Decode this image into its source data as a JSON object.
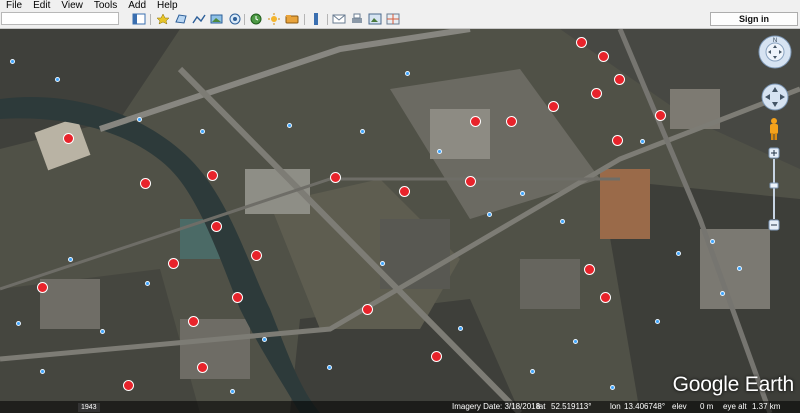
{
  "menu": [
    "File",
    "Edit",
    "View",
    "Tools",
    "Add",
    "Help"
  ],
  "toolbar": {
    "search_placeholder": "",
    "buttons": [
      "sidebar-toggle-icon",
      "placemark-icon",
      "polygon-icon",
      "path-icon",
      "image-overlay-icon",
      "record-tour-icon",
      "historical-imagery-icon",
      "sun-icon",
      "planets-icon",
      "ruler-icon",
      "email-icon",
      "print-icon",
      "save-image-icon",
      "maps-icon"
    ],
    "sign_in": "Sign in"
  },
  "status": {
    "history_year": "1943",
    "imagery_date": "Imagery Date: 3/18/2018",
    "lat": "lat",
    "lat_val": "52.519113°",
    "lon": "lon",
    "lon_val": "13.406748°",
    "elev": "elev",
    "elev_val": "0 m",
    "eye_alt": "eye alt",
    "eye_alt_val": "1.37 km"
  },
  "brand": "Google Earth",
  "colors": {
    "pin": "#e8232b",
    "dot": "#3ea6ff",
    "chrome": "#f0f0f0"
  }
}
